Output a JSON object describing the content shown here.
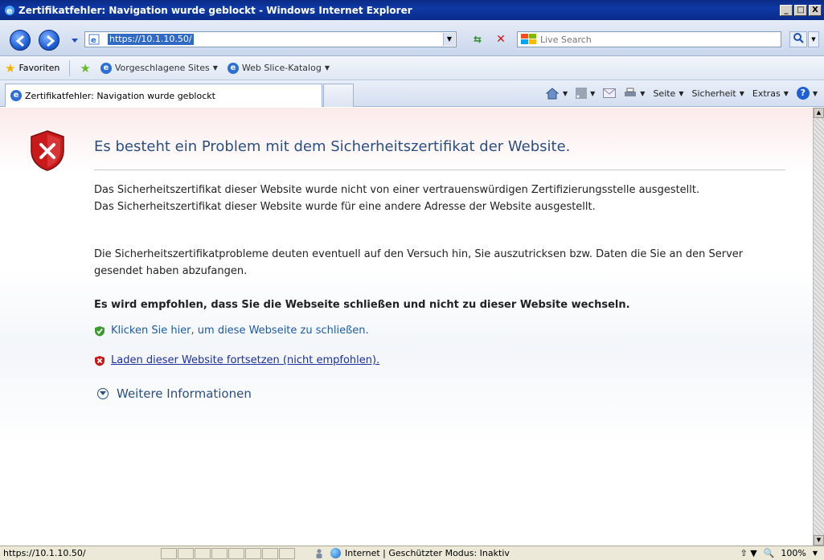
{
  "window": {
    "title": "Zertifikatfehler: Navigation wurde geblockt - Windows Internet Explorer",
    "buttons": {
      "minimize": "_",
      "maximize": "□",
      "close": "X"
    }
  },
  "addressbar": {
    "url": "https://10.1.10.50/",
    "search_placeholder": "Live Search"
  },
  "favorites_bar": {
    "favorites_label": "Favoriten",
    "items": [
      "Vorgeschlagene Sites",
      "Web Slice-Katalog"
    ]
  },
  "tabs": {
    "active_tab": "Zertifikatfehler: Navigation wurde geblockt"
  },
  "command_bar": {
    "page": "Seite",
    "safety": "Sicherheit",
    "extras": "Extras"
  },
  "content": {
    "heading": "Es besteht ein Problem mit dem Sicherheitszertifikat der Website.",
    "para1_line1": "Das Sicherheitszertifikat dieser Website wurde nicht von einer vertrauenswürdigen Zertifizierungsstelle ausgestellt.",
    "para1_line2": "Das Sicherheitszertifikat dieser Website wurde für eine andere Adresse der Website ausgestellt.",
    "para2": "Die Sicherheitszertifikatprobleme deuten eventuell auf den Versuch hin, Sie auszutricksen bzw. Daten die Sie an den Server gesendet haben abzufangen.",
    "recommendation": "Es wird empfohlen, dass Sie die Webseite schließen und nicht zu dieser Website wechseln.",
    "close_link": "Klicken Sie hier, um diese Webseite zu schließen.",
    "continue_link": "Laden dieser Website fortsetzen (nicht empfohlen).",
    "more_info": "Weitere Informationen"
  },
  "statusbar": {
    "url": "https://10.1.10.50/",
    "zone": "Internet | Geschützter Modus: Inaktiv",
    "zoom": "100%"
  },
  "colors": {
    "titlebar": "#0f3aa6",
    "heading": "#2c4f82",
    "link": "#1d5aa7",
    "shield_red": "#c8191b",
    "ok_green": "#3a9a2c"
  }
}
